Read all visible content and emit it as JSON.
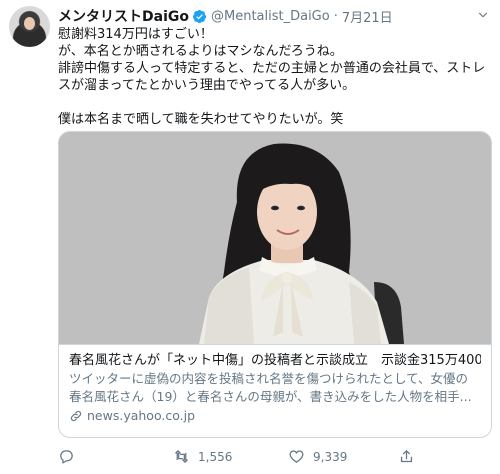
{
  "tweet": {
    "display_name": "メンタリストDaiGo",
    "handle": "@Mentalist_DaiGo",
    "separator": "·",
    "date": "7月21日",
    "lines": [
      "慰謝料314万円はすごい！",
      "が、本名とか晒されるよりはマシなんだろうね。",
      "誹謗中傷する人って特定すると、ただの主婦とか普通の会社員で、ストレ",
      "スが溜まってたとかいう理由でやってる人が多い。",
      "",
      "僕は本名まで晒して職を失わせてやりたいが。笑"
    ]
  },
  "card": {
    "title": "春名風花さんが「ネット中傷」の投稿者と示談成立　示談金315万400...",
    "description_lines": [
      "ツイッターに虚偽の内容を投稿され名誉を傷つけられたとして、女優の",
      "春名風花さん（19）と春名さんの母親が、書き込みをした人物を相手..."
    ],
    "domain": "news.yahoo.co.jp"
  },
  "actions": {
    "reply_count": "",
    "retweet_count": "1,556",
    "like_count": "9,339"
  },
  "colors": {
    "verified": "#1da1f2",
    "secondary_text": "#657786",
    "border": "#ccd6dd"
  },
  "icons": [
    "verified-badge-icon",
    "caret-down-icon",
    "link-icon",
    "reply-icon",
    "retweet-icon",
    "like-icon",
    "share-icon"
  ]
}
